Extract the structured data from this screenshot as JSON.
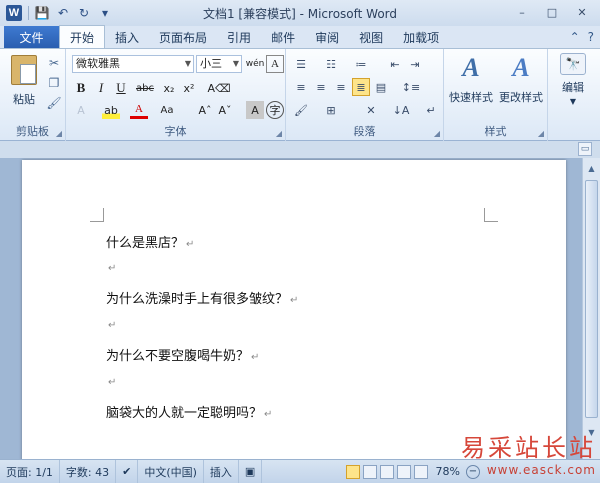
{
  "title": "文档1 [兼容模式] - Microsoft Word",
  "qat": {
    "save": "💾",
    "undo": "↶",
    "redo": "↻"
  },
  "window": {
    "minimize": "–",
    "maximize": "□",
    "close": "✕"
  },
  "tabs": {
    "file": "文件",
    "items": [
      "开始",
      "插入",
      "页面布局",
      "引用",
      "邮件",
      "审阅",
      "视图",
      "加载项"
    ],
    "help": "?"
  },
  "ribbon": {
    "clipboard": {
      "paste": "粘贴",
      "label": "剪贴板"
    },
    "font": {
      "name": "微软雅黑",
      "size": "小三",
      "label": "字体"
    },
    "paragraph": {
      "label": "段落"
    },
    "styles": {
      "quick": "快速样式",
      "change": "更改样式",
      "label": "样式"
    },
    "editing": {
      "label": "编辑"
    }
  },
  "document": {
    "paragraphs": [
      "什么是黑店？",
      "",
      "为什么洗澡时手上有很多皱纹？",
      "",
      "为什么不要空腹喝牛奶？",
      "",
      "脑袋大的人就一定聪明吗？"
    ],
    "para_mark": "↵"
  },
  "status": {
    "page": "页面: 1/1",
    "words": "字数: 43",
    "language": "中文(中国)",
    "mode": "插入",
    "zoom": "78%"
  },
  "watermark": {
    "line1": "易采站长站",
    "line2": "www.easck.com"
  }
}
